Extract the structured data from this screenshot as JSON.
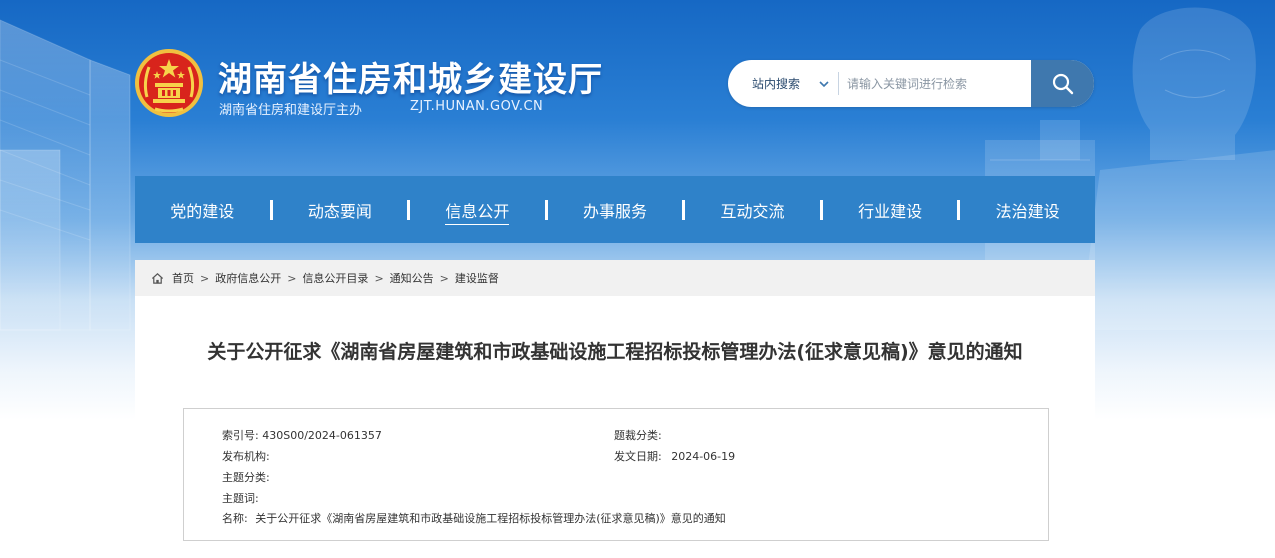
{
  "header": {
    "site_title": "湖南省住房和城乡建设厅",
    "site_subtitle": "湖南省住房和建设厅主办",
    "site_domain": "ZJT.HUNAN.GOV.CN"
  },
  "search": {
    "scope_label": "站内搜索",
    "placeholder": "请输入关键词进行检索",
    "value": ""
  },
  "nav": {
    "items": [
      {
        "label": "党的建设"
      },
      {
        "label": "动态要闻"
      },
      {
        "label": "信息公开"
      },
      {
        "label": "办事服务"
      },
      {
        "label": "互动交流"
      },
      {
        "label": "行业建设"
      },
      {
        "label": "法治建设"
      }
    ],
    "active_index": 2
  },
  "breadcrumb": {
    "items": [
      "首页",
      "政府信息公开",
      "信息公开目录",
      "通知公告",
      "建设监督"
    ],
    "separator": ">"
  },
  "article": {
    "title": "关于公开征求《湖南省房屋建筑和市政基础设施工程招标投标管理办法(征求意见稿)》意见的通知"
  },
  "meta": {
    "index_label": "索引号:",
    "index_value": "430S00/2024-061357",
    "category_label": "题裁分类:",
    "category_value": "",
    "publisher_label": "发布机构:",
    "publisher_value": "",
    "date_label": "发文日期:",
    "date_value": "2024-06-19",
    "topic_label": "主题分类:",
    "topic_value": "",
    "keyword_label": "主题词:",
    "keyword_value": "",
    "name_label": "名称:",
    "name_value": "关于公开征求《湖南省房屋建筑和市政基础设施工程招标投标管理办法(征求意见稿)》意见的通知"
  },
  "colors": {
    "nav_bg": "#2f82c9",
    "search_button": "#3f78ae",
    "header_bg": "#1668c4"
  },
  "icons": {
    "emblem": "national-emblem-icon",
    "search": "search-icon",
    "chevron": "chevron-down-icon",
    "home": "home-icon"
  }
}
